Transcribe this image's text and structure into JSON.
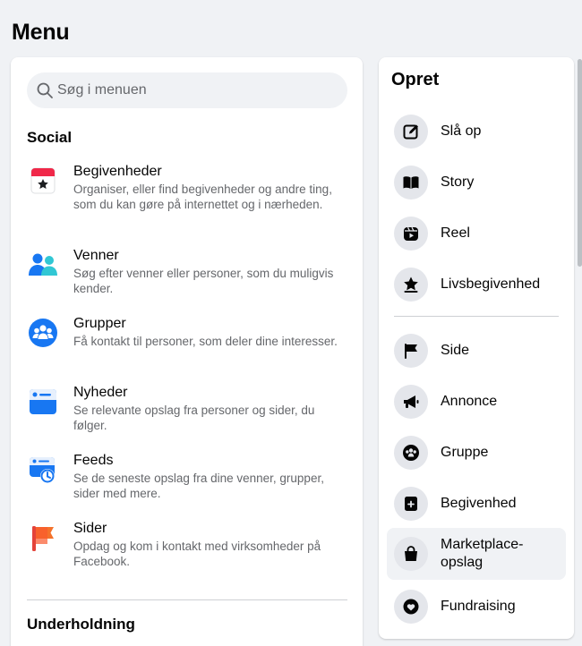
{
  "page": {
    "title": "Menu"
  },
  "search": {
    "placeholder": "Søg i menuen"
  },
  "social": {
    "title": "Social",
    "items": [
      {
        "name": "Begivenheder",
        "desc": "Organiser, eller find begivenheder og andre ting, som du kan gøre på internettet og i nærheden.",
        "icon": "calendar-star-icon"
      },
      {
        "name": "Venner",
        "desc": "Søg efter venner eller personer, som du muligvis kender.",
        "icon": "friends-icon"
      },
      {
        "name": "Grupper",
        "desc": "Få kontakt til personer, som deler dine interesser.",
        "icon": "groups-icon"
      },
      {
        "name": "Nyheder",
        "desc": "Se relevante opslag fra personer og sider, du følger.",
        "icon": "news-feed-icon"
      },
      {
        "name": "Feeds",
        "desc": "Se de seneste opslag fra dine venner, grupper, sider med mere.",
        "icon": "feeds-clock-icon"
      },
      {
        "name": "Sider",
        "desc": "Opdag og kom i kontakt med virksomheder på Facebook.",
        "icon": "pages-flag-icon"
      }
    ]
  },
  "entertainment": {
    "title": "Underholdning"
  },
  "create": {
    "title": "Opret",
    "items": [
      {
        "label": "Slå op",
        "icon": "compose-icon"
      },
      {
        "label": "Story",
        "icon": "book-icon"
      },
      {
        "label": "Reel",
        "icon": "reel-icon"
      },
      {
        "label": "Livsbegivenhed",
        "icon": "life-event-star-icon"
      },
      {
        "label": "Side",
        "icon": "flag-icon"
      },
      {
        "label": "Annonce",
        "icon": "megaphone-icon"
      },
      {
        "label": "Gruppe",
        "icon": "group-icon"
      },
      {
        "label": "Begivenhed",
        "icon": "event-plus-icon"
      },
      {
        "label": "Marketplace-opslag",
        "icon": "shopping-bag-icon"
      },
      {
        "label": "Fundraising",
        "icon": "fundraiser-icon"
      }
    ]
  },
  "colors": {
    "accent": "#1877f2",
    "text_primary": "#050505",
    "text_secondary": "#65676b",
    "background": "#f0f2f5"
  }
}
